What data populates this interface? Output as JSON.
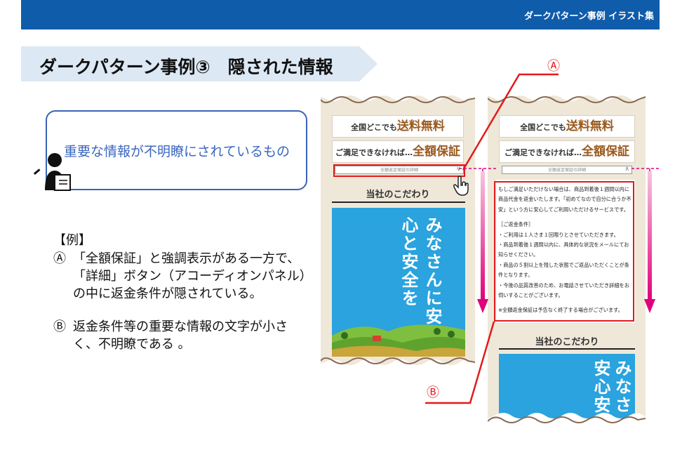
{
  "header": {
    "title": "ダークパターン事例 イラスト集"
  },
  "slide": {
    "title": "ダークパターン事例③　隠された情報"
  },
  "callout": {
    "text": "重要な情報が不明瞭にされているもの"
  },
  "example": {
    "heading": "【例】",
    "items": [
      {
        "mark": "Ⓐ",
        "text": "「全額保証」と強調表示がある一方で、「詳細」ボタン（アコーディオンパネル）の中に返金条件が隠されている。"
      },
      {
        "mark": "Ⓑ",
        "text": "返金条件等の重要な情報の文字が小さく、不明瞭である 。"
      }
    ]
  },
  "markers": {
    "a": "Ⓐ",
    "b": "Ⓑ"
  },
  "phone": {
    "shipping_small": "全国どこでも",
    "shipping_big": "送料無料",
    "guarantee_small": "ご満足できなければ…",
    "guarantee_big": "全額保証",
    "accordion_label": "全額返金保証の詳細",
    "accordion_closed_icon": "chevron-down-icon",
    "accordion_open_icon": "chevron-up-icon",
    "section_title": "当社のこだわり",
    "poster_text": "みなさんに安心と安全を",
    "poster_text_partial": "みなさ安心安",
    "conditions": [
      "もしご満足いただけない場合は、商品到着後１週間以内に商品代金を返金いたします。「初めてなので自分に合うか不安」という方に安心してご利用いただけるサービスです。",
      "［ご返金条件］",
      "・ご利用は１人さま１回限りとさせていただきます。",
      "・商品到着後１週間以内に、具体的な状況をメールにてお知らせください。",
      "・商品の５割以上を残した状態でご返品いただくことが条件となります。",
      "・今後の品質改善のため、お電話させていただき詳細をお伺いすることがございます。",
      "※全額返金保証は予告なく終了する場合がございます。"
    ]
  },
  "colors": {
    "accent": "#0f5cab",
    "red": "#e21b1b",
    "magenta": "#e0007a",
    "poster": "#2aa3de",
    "gold": "#9a5a1e"
  }
}
